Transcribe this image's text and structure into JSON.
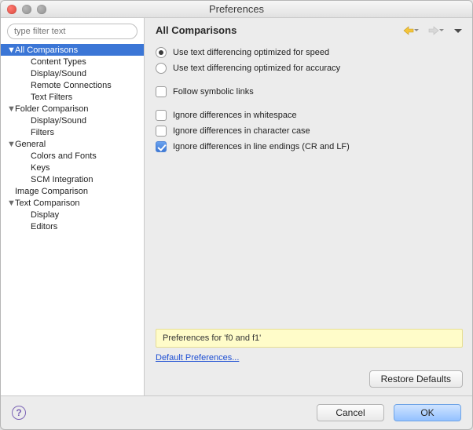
{
  "window": {
    "title": "Preferences"
  },
  "filter": {
    "placeholder": "type filter text"
  },
  "tree": {
    "items": [
      {
        "label": "All Comparisons",
        "depth": 0,
        "expandable": true,
        "expanded": true,
        "selected": true
      },
      {
        "label": "Content Types",
        "depth": 1,
        "expandable": false
      },
      {
        "label": "Display/Sound",
        "depth": 1,
        "expandable": false
      },
      {
        "label": "Remote Connections",
        "depth": 1,
        "expandable": false
      },
      {
        "label": "Text Filters",
        "depth": 1,
        "expandable": false
      },
      {
        "label": "Folder Comparison",
        "depth": 0,
        "expandable": true,
        "expanded": true
      },
      {
        "label": "Display/Sound",
        "depth": 1,
        "expandable": false
      },
      {
        "label": "Filters",
        "depth": 1,
        "expandable": false
      },
      {
        "label": "General",
        "depth": 0,
        "expandable": true,
        "expanded": true
      },
      {
        "label": "Colors and Fonts",
        "depth": 1,
        "expandable": false
      },
      {
        "label": "Keys",
        "depth": 1,
        "expandable": false
      },
      {
        "label": "SCM Integration",
        "depth": 1,
        "expandable": false
      },
      {
        "label": "Image Comparison",
        "depth": 0,
        "expandable": false
      },
      {
        "label": "Text Comparison",
        "depth": 0,
        "expandable": true,
        "expanded": true
      },
      {
        "label": "Display",
        "depth": 1,
        "expandable": false
      },
      {
        "label": "Editors",
        "depth": 1,
        "expandable": false
      }
    ]
  },
  "page": {
    "title": "All Comparisons",
    "radio_speed": "Use text differencing optimized for speed",
    "radio_accuracy": "Use text differencing optimized for accuracy",
    "follow_symlinks": "Follow symbolic links",
    "ignore_ws": "Ignore differences in whitespace",
    "ignore_case": "Ignore differences in character case",
    "ignore_crlf": "Ignore differences in line endings (CR and LF)",
    "banner": "Preferences for 'f0 and f1'",
    "default_link": "Default Preferences...",
    "restore": "Restore Defaults"
  },
  "state": {
    "diff_mode": "speed",
    "follow_symlinks": false,
    "ignore_ws": false,
    "ignore_case": false,
    "ignore_crlf": true
  },
  "footer": {
    "cancel": "Cancel",
    "ok": "OK"
  },
  "nav": {
    "back_enabled": true,
    "forward_enabled": false
  }
}
